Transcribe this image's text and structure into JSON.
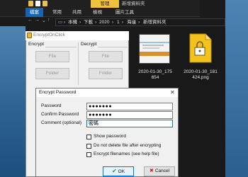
{
  "explorer": {
    "manage_tab": "管理",
    "window_title": "新增資料夾",
    "ribbon_tabs": [
      "檔案",
      "常用",
      "共用",
      "檢視",
      "圖片工具"
    ],
    "breadcrumb": [
      "本機",
      "下載",
      "2020",
      "1",
      "海龜",
      "新增資料夾"
    ],
    "files": [
      {
        "name_line1": "2020-01-30_175",
        "name_line2": "654"
      },
      {
        "name_line1": "2020-01-30_181",
        "name_line2": "424.png"
      }
    ]
  },
  "encrypt_app": {
    "title": "EncryptOnClick",
    "encrypt_label": "Encrypt",
    "decrypt_label": "Decrypt",
    "file_button": "File",
    "folder_button": "Folder"
  },
  "dialog": {
    "title": "Encrypt Password",
    "close_glyph": "✕",
    "password_label": "Password",
    "password_value": "●●●●●●●",
    "confirm_label": "Confirm Password",
    "confirm_value": "●●●●●●●",
    "comment_label": "Comment (optional)",
    "comment_value": "密碼",
    "options": [
      "Show password",
      "Do not delete file after encrypting",
      "Encrypt filenames (see help file)"
    ],
    "ok_label": "OK",
    "cancel_label": "Cancel"
  },
  "colors": {
    "accent": "#0078d7",
    "explorer_bg": "#1b1b1b",
    "manage_tab": "#f0c13a"
  }
}
